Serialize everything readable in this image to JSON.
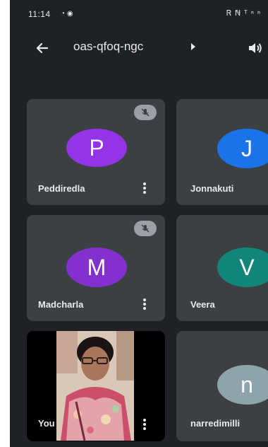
{
  "status": {
    "time": "11:14",
    "left_icons": "◔ ◉",
    "right_icons": "Ꮢ ℕ ᵀ ⁿ ⁿ"
  },
  "header": {
    "meeting_code": "oas-qfoq-ngc",
    "icons": {
      "back": "arrow-back-icon",
      "chevron": "chevron-right-icon",
      "audio": "speaker-icon"
    }
  },
  "participants": [
    {
      "initial": "P",
      "name": "Peddiredla",
      "color": "#9334e6",
      "muted": true
    },
    {
      "initial": "J",
      "name": "Jonnakuti",
      "color": "#1a73e8",
      "muted": false
    },
    {
      "initial": "M",
      "name": "Madcharla",
      "color": "#8430ce",
      "muted": true
    },
    {
      "initial": "V",
      "name": "Veera",
      "color": "#12857a",
      "muted": false
    },
    {
      "initial": "",
      "name": "You",
      "color": "",
      "muted": false,
      "video": true
    },
    {
      "initial": "n",
      "name": "narredimilli",
      "color": "#8fa3ad",
      "muted": false
    }
  ]
}
